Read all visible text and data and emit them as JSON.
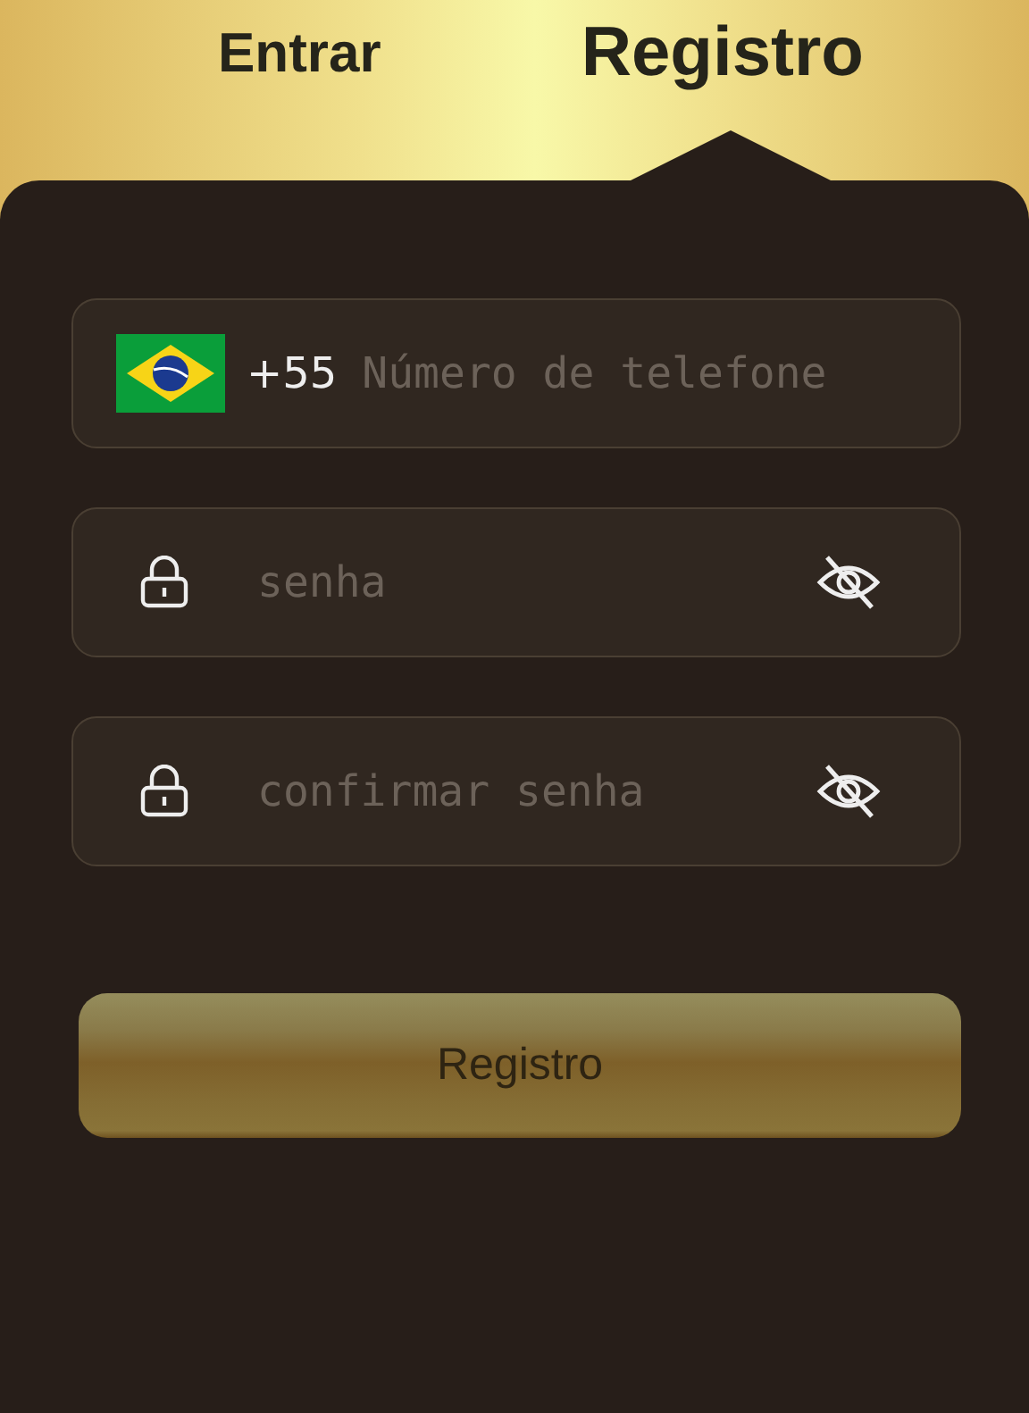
{
  "tabs": [
    {
      "label": "Entrar",
      "selected": false
    },
    {
      "label": "Registro",
      "selected": true
    }
  ],
  "fields": [
    {
      "kind": "phone",
      "country_code": "+55",
      "placeholder": "Número de telefone"
    },
    {
      "kind": "password",
      "placeholder": "senha",
      "visible": false
    },
    {
      "kind": "password",
      "placeholder": "confirmar senha",
      "visible": false
    }
  ],
  "submit_button": "Registro"
}
